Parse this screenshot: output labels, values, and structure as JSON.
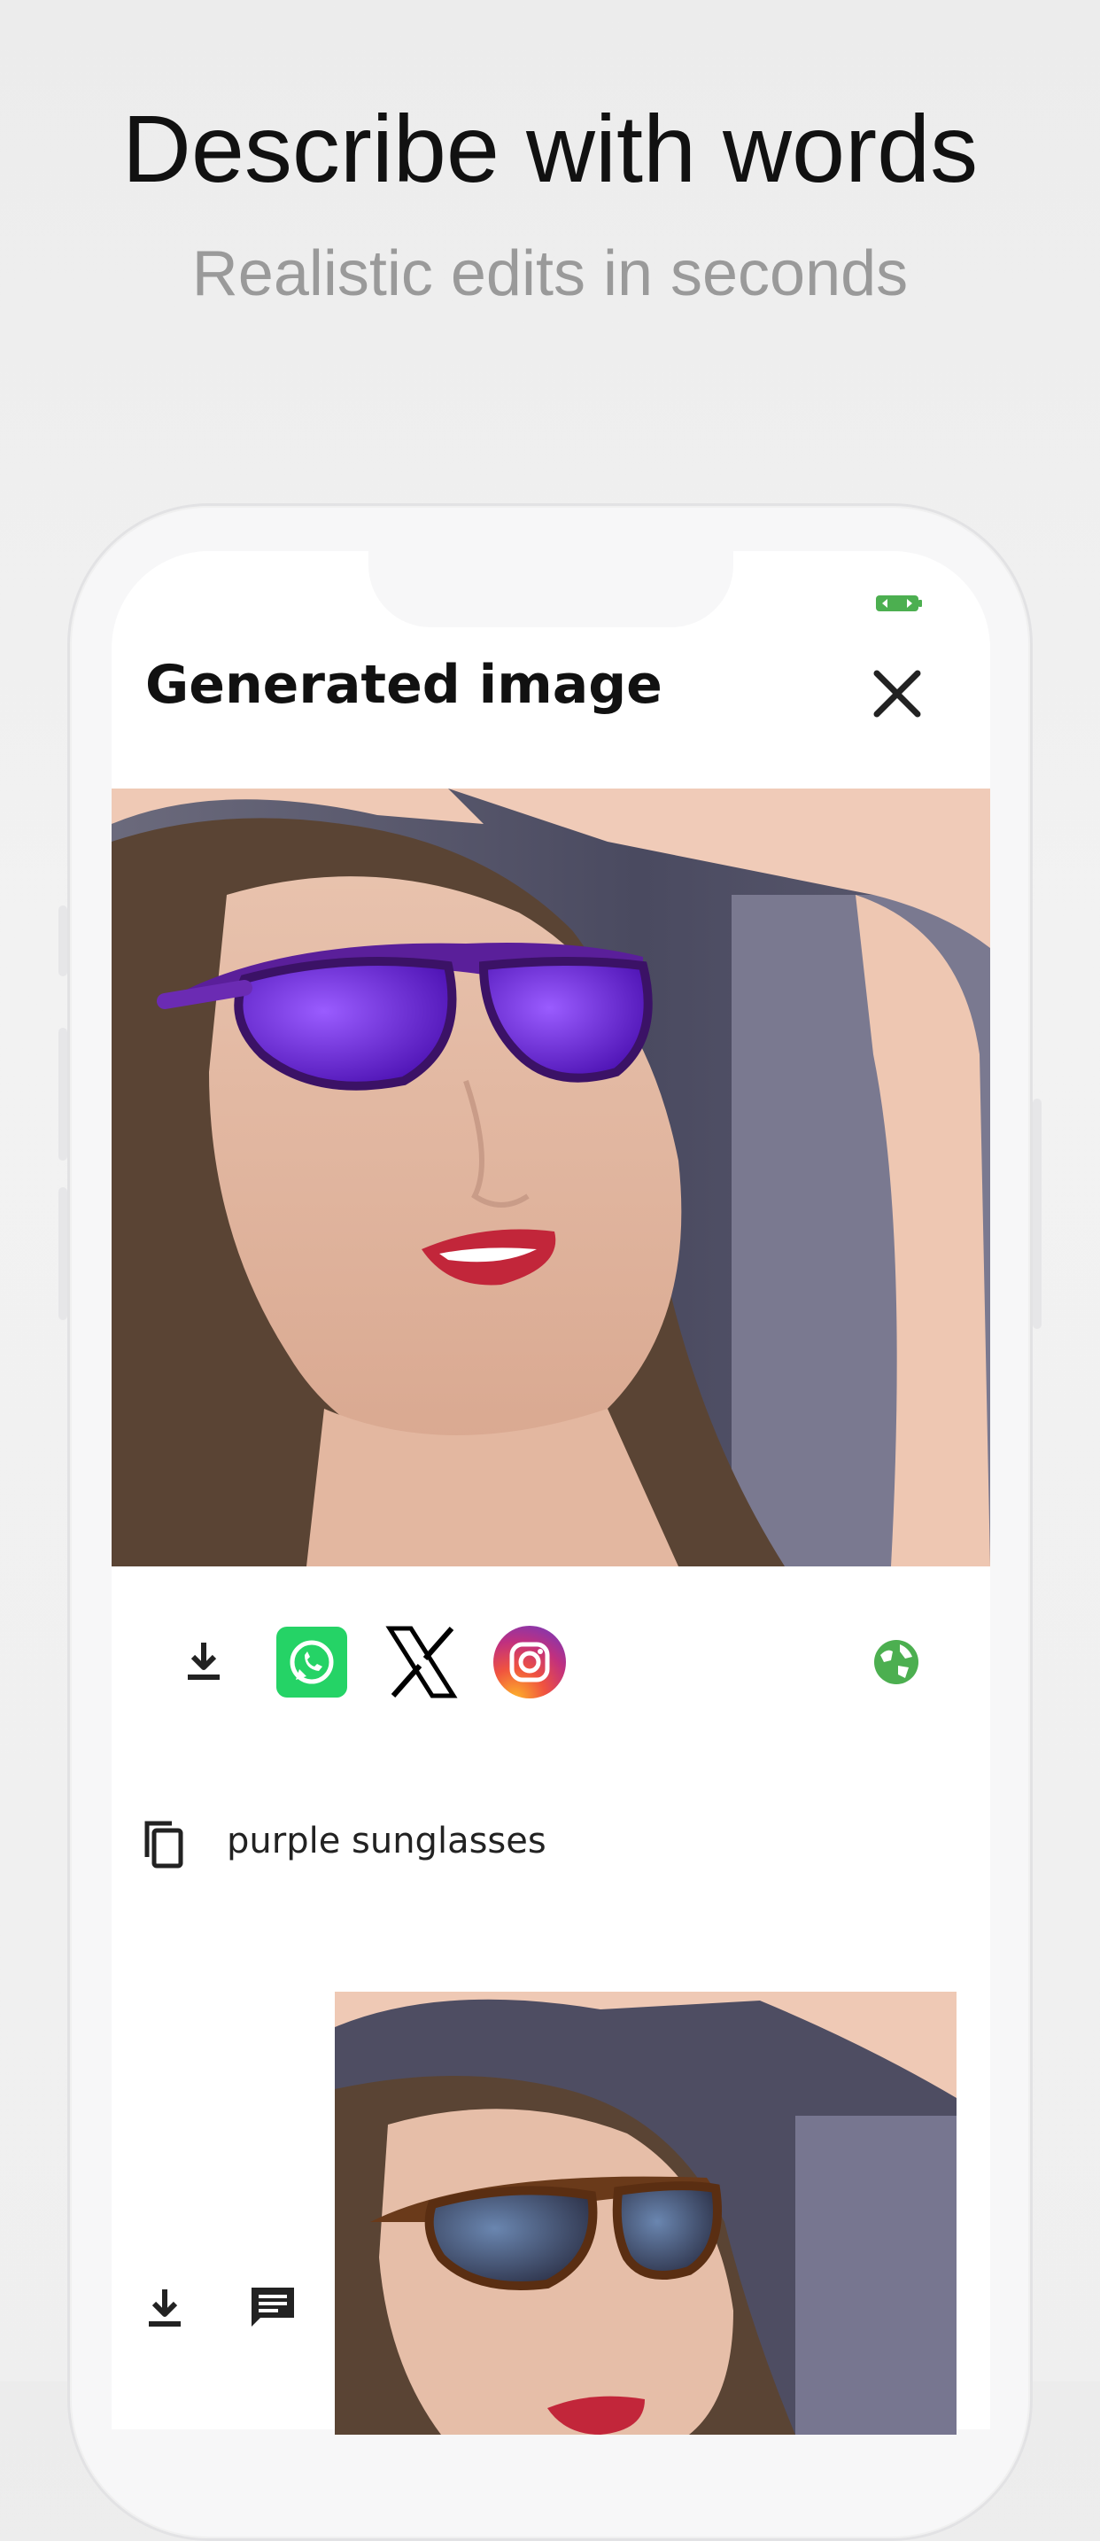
{
  "header": {
    "headline": "Describe with words",
    "subline": "Realistic edits in seconds"
  },
  "app": {
    "title": "Generated image",
    "prompt": "purple sunglasses"
  },
  "icons": {
    "close": "close-icon",
    "download": "download-icon",
    "whatsapp": "whatsapp-icon",
    "x": "x-icon",
    "instagram": "instagram-icon",
    "globe": "globe-icon",
    "copy": "copy-icon",
    "comment": "comment-icon",
    "battery": "battery-icon"
  },
  "colors": {
    "accent_green": "#4caf50",
    "whatsapp_green": "#25d366",
    "sunglasses_purple": "#6a1fd8"
  }
}
